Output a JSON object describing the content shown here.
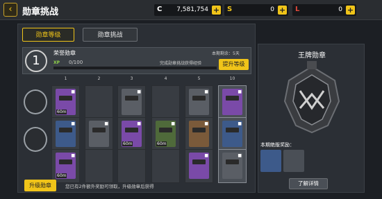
{
  "header": {
    "back_icon": "back-arrow-icon",
    "title": "勋章挑战",
    "currencies": [
      {
        "icon": "C",
        "color": "#ffffff",
        "value": "7,581,754"
      },
      {
        "icon": "S",
        "color": "#f0c419",
        "value": "0"
      },
      {
        "icon": "L",
        "color": "#e0483a",
        "value": "0"
      }
    ],
    "plus": "+"
  },
  "tabs": [
    {
      "label": "勋章等级",
      "active": true
    },
    {
      "label": "勋章挑战",
      "active": false
    }
  ],
  "rank": {
    "level": "1",
    "name": "荣誉勋章",
    "xp_label": "XP",
    "xp_value": "0/100",
    "xp_progress": 0,
    "hint": "完成勋章挑战获得经验",
    "remaining": "本期剩余：5天",
    "upgrade_button": "提升等级"
  },
  "columns": [
    "1",
    "2",
    "3",
    "4",
    "5",
    "10"
  ],
  "rows": [
    {
      "icon": "winged-emblem-icon",
      "items": [
        {
          "rarity": "purple",
          "tag": "60m",
          "locked": true
        },
        null,
        {
          "rarity": "gray",
          "tag": "",
          "locked": true
        },
        null,
        {
          "rarity": "gray",
          "tag": "",
          "locked": true
        },
        {
          "rarity": "purple",
          "tag": "",
          "locked": true
        }
      ]
    },
    {
      "icon": "target-emblem-icon",
      "items": [
        {
          "rarity": "blue",
          "tag": "",
          "locked": true
        },
        {
          "rarity": "gray",
          "tag": "",
          "locked": true
        },
        {
          "rarity": "purple",
          "tag": "60m",
          "locked": true
        },
        {
          "rarity": "green",
          "tag": "60m",
          "locked": true
        },
        {
          "rarity": "bronze",
          "tag": "",
          "locked": true
        },
        {
          "rarity": "blue",
          "tag": "",
          "locked": true
        }
      ]
    },
    {
      "icon": "",
      "items": [
        {
          "rarity": "purple",
          "tag": "60m",
          "locked": true
        },
        null,
        null,
        null,
        {
          "rarity": "purple",
          "tag": "",
          "locked": true
        },
        {
          "rarity": "gray",
          "tag": "",
          "locked": true
        }
      ]
    }
  ],
  "footer": {
    "promote_button": "升级勋章",
    "note": "您已有2件额外奖励可领取，升级勋章后获得"
  },
  "side": {
    "title": "王牌勋章",
    "reward_label": "本期绝版奖励：",
    "detail_button": "了解详情"
  }
}
